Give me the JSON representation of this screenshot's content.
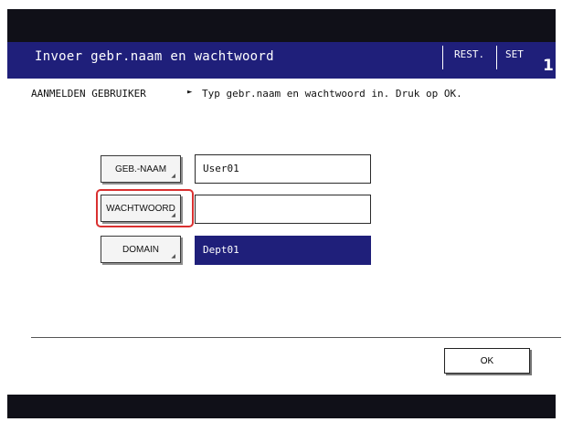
{
  "header": {
    "title": "Invoer gebr.naam en wachtwoord",
    "rest_label": "REST.",
    "set_label": "SET",
    "set_count": "1"
  },
  "instruction_row": {
    "section_label": "AANMELDEN GEBRUIKER",
    "arrow_glyph": "►",
    "text": "Typ gebr.naam en wachtwoord in. Druk op OK."
  },
  "form": {
    "rows": [
      {
        "button_label": "GEB.-NAAM",
        "value": "User01",
        "selected": false
      },
      {
        "button_label": "WACHTWOORD",
        "value": "",
        "selected": false,
        "highlighted": true
      },
      {
        "button_label": "DOMAIN",
        "value": "Dept01",
        "selected": true
      }
    ]
  },
  "footer": {
    "ok_label": "OK"
  },
  "colors": {
    "title_bar": "#1f1f7a",
    "selected_field": "#1f1f7a",
    "highlight": "#d93030",
    "frame": "#101018"
  }
}
